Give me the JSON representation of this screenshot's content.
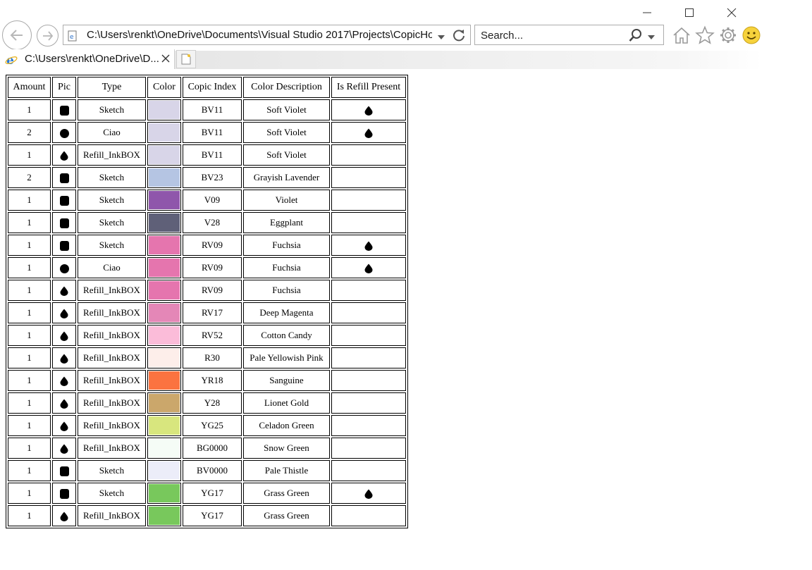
{
  "browser": {
    "address": "C:\\Users\\renkt\\OneDrive\\Documents\\Visual Studio 2017\\Projects\\CopicHo",
    "search_placeholder": "Search...",
    "tab_title": "C:\\Users\\renkt\\OneDrive\\D..."
  },
  "table": {
    "headers": [
      "Amount",
      "Pic",
      "Type",
      "Color",
      "Copic Index",
      "Color Description",
      "Is Refill Present"
    ],
    "rows": [
      {
        "amount": "1",
        "pic": "square-icon",
        "type": "Sketch",
        "color": "#d8d5e8",
        "index": "BV11",
        "desc": "Soft Violet",
        "refill": true
      },
      {
        "amount": "2",
        "pic": "circle-icon",
        "type": "Ciao",
        "color": "#d8d5e8",
        "index": "BV11",
        "desc": "Soft Violet",
        "refill": true
      },
      {
        "amount": "1",
        "pic": "drop-icon",
        "type": "Refill_InkBOX",
        "color": "#d8d5e8",
        "index": "BV11",
        "desc": "Soft Violet",
        "refill": false
      },
      {
        "amount": "2",
        "pic": "square-icon",
        "type": "Sketch",
        "color": "#b5c5e3",
        "index": "BV23",
        "desc": "Grayish Lavender",
        "refill": false
      },
      {
        "amount": "1",
        "pic": "square-icon",
        "type": "Sketch",
        "color": "#8f56ab",
        "index": "V09",
        "desc": "Violet",
        "refill": false
      },
      {
        "amount": "1",
        "pic": "square-icon",
        "type": "Sketch",
        "color": "#5f6078",
        "index": "V28",
        "desc": "Eggplant",
        "refill": false
      },
      {
        "amount": "1",
        "pic": "square-icon",
        "type": "Sketch",
        "color": "#e575ae",
        "index": "RV09",
        "desc": "Fuchsia",
        "refill": true
      },
      {
        "amount": "1",
        "pic": "circle-icon",
        "type": "Ciao",
        "color": "#e575ae",
        "index": "RV09",
        "desc": "Fuchsia",
        "refill": true
      },
      {
        "amount": "1",
        "pic": "drop-icon",
        "type": "Refill_InkBOX",
        "color": "#e575ae",
        "index": "RV09",
        "desc": "Fuchsia",
        "refill": false
      },
      {
        "amount": "1",
        "pic": "drop-icon",
        "type": "Refill_InkBOX",
        "color": "#e487b7",
        "index": "RV17",
        "desc": "Deep Magenta",
        "refill": false
      },
      {
        "amount": "1",
        "pic": "drop-icon",
        "type": "Refill_InkBOX",
        "color": "#fbbcd9",
        "index": "RV52",
        "desc": "Cotton Candy",
        "refill": false
      },
      {
        "amount": "1",
        "pic": "drop-icon",
        "type": "Refill_InkBOX",
        "color": "#fdeeea",
        "index": "R30",
        "desc": "Pale Yellowish Pink",
        "refill": false
      },
      {
        "amount": "1",
        "pic": "drop-icon",
        "type": "Refill_InkBOX",
        "color": "#fb7340",
        "index": "YR18",
        "desc": "Sanguine",
        "refill": false
      },
      {
        "amount": "1",
        "pic": "drop-icon",
        "type": "Refill_InkBOX",
        "color": "#cba76b",
        "index": "Y28",
        "desc": "Lionet Gold",
        "refill": false
      },
      {
        "amount": "1",
        "pic": "drop-icon",
        "type": "Refill_InkBOX",
        "color": "#d8e67e",
        "index": "YG25",
        "desc": "Celadon Green",
        "refill": false
      },
      {
        "amount": "1",
        "pic": "drop-icon",
        "type": "Refill_InkBOX",
        "color": "#f5fcf6",
        "index": "BG0000",
        "desc": "Snow Green",
        "refill": false
      },
      {
        "amount": "1",
        "pic": "square-icon",
        "type": "Sketch",
        "color": "#ecedf9",
        "index": "BV0000",
        "desc": "Pale Thistle",
        "refill": false
      },
      {
        "amount": "1",
        "pic": "square-icon",
        "type": "Sketch",
        "color": "#78c85c",
        "index": "YG17",
        "desc": "Grass Green",
        "refill": true
      },
      {
        "amount": "1",
        "pic": "drop-icon",
        "type": "Refill_InkBOX",
        "color": "#78c85c",
        "index": "YG17",
        "desc": "Grass Green",
        "refill": false
      }
    ]
  }
}
